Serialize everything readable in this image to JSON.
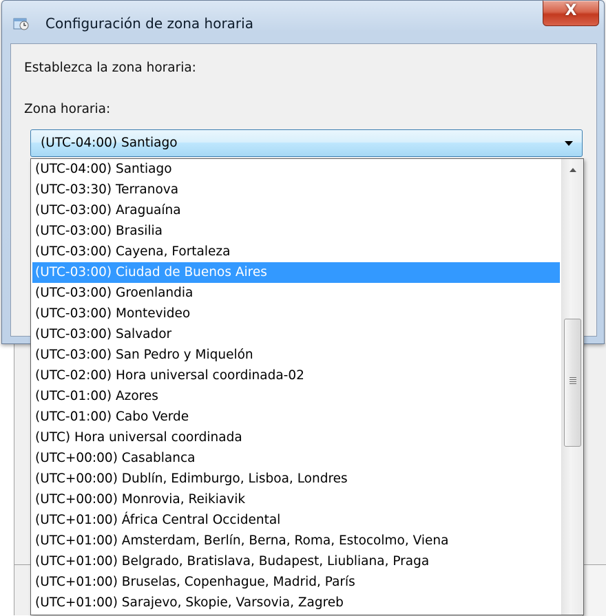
{
  "window": {
    "title": "Configuración de zona horaria",
    "close_label": "X"
  },
  "dialog": {
    "prompt": "Establezca la zona horaria:",
    "zone_label": "Zona horaria:",
    "selected_value": "(UTC-04:00) Santiago"
  },
  "dropdown": {
    "highlighted_index": 5,
    "options": [
      "(UTC-04:00) Santiago",
      "(UTC-03:30) Terranova",
      "(UTC-03:00) Araguaína",
      "(UTC-03:00) Brasilia",
      "(UTC-03:00) Cayena, Fortaleza",
      "(UTC-03:00) Ciudad de Buenos Aires",
      "(UTC-03:00) Groenlandia",
      "(UTC-03:00) Montevideo",
      "(UTC-03:00) Salvador",
      "(UTC-03:00) San Pedro y Miquelón",
      "(UTC-02:00) Hora universal coordinada-02",
      "(UTC-01:00) Azores",
      "(UTC-01:00) Cabo Verde",
      "(UTC) Hora universal coordinada",
      "(UTC+00:00) Casablanca",
      "(UTC+00:00) Dublín, Edimburgo, Lisboa, Londres",
      "(UTC+00:00) Monrovia, Reikiavik",
      "(UTC+01:00) África Central Occidental",
      "(UTC+01:00) Amsterdam, Berlín, Berna, Roma, Estocolmo, Viena",
      "(UTC+01:00) Belgrado, Bratislava, Budapest, Liubliana, Praga",
      "(UTC+01:00) Bruselas, Copenhague, Madrid, París",
      "(UTC+01:00) Sarajevo, Skopie, Varsovia, Zagreb"
    ]
  },
  "colors": {
    "selection": "#3399ff",
    "close_button": "#c33a1f"
  }
}
